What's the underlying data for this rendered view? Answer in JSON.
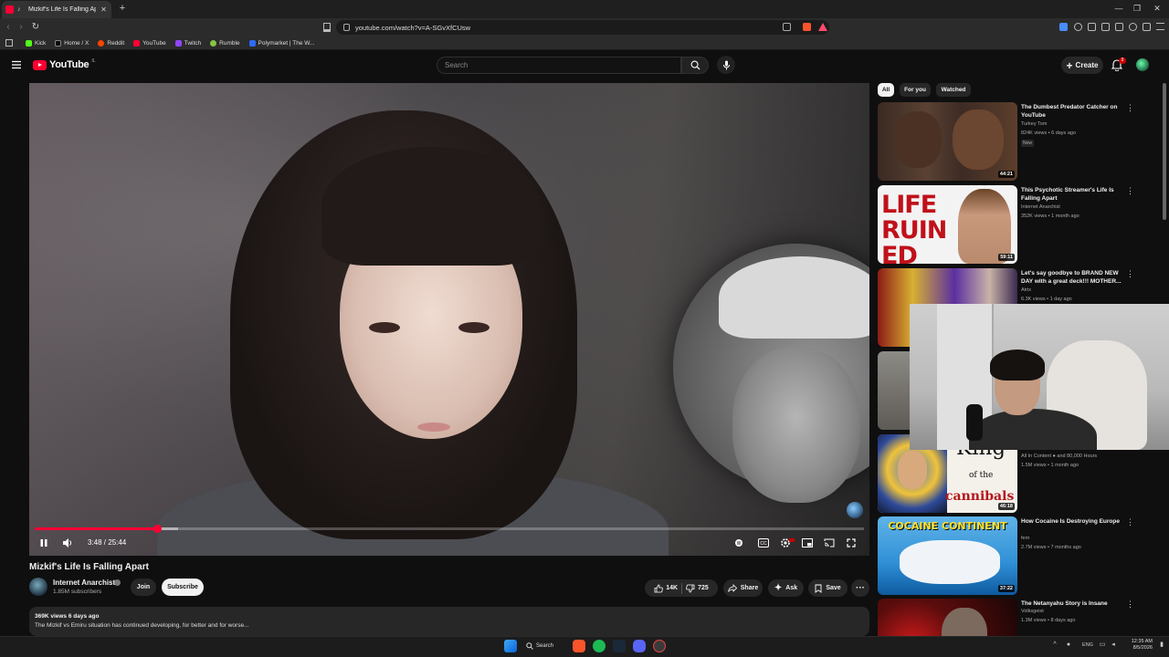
{
  "browser": {
    "tab_title": "Mizkif's Life Is Falling Apart",
    "url": "youtube.com/watch?v=A-SGvXfCUsw",
    "bookmarks": [
      "Kick",
      "Home / X",
      "Reddit",
      "YouTube",
      "Twitch",
      "Rumble",
      "Polymarket | The W..."
    ]
  },
  "header": {
    "logo_text": "YouTube",
    "logo_country": "IL",
    "search_placeholder": "Search",
    "create_label": "Create",
    "notification_count": "9"
  },
  "player": {
    "current_time": "3:48",
    "duration": "25:44",
    "time_display": "3:48 / 25:44",
    "progress_fraction": 0.148,
    "buffered_fraction": 0.173
  },
  "video": {
    "title": "Mizkif's Life Is Falling Apart",
    "channel": "Internet Anarchist",
    "subscribers": "1.85M subscribers",
    "join_label": "Join",
    "subscribe_label": "Subscribe",
    "likes": "14K",
    "dislikes": "725",
    "share_label": "Share",
    "ask_label": "Ask",
    "save_label": "Save",
    "views_date": "369K views  6 days ago",
    "description": "The Mizkif vs Emiru situation has continued developing, for better and for worse..."
  },
  "chips": [
    "All",
    "For you",
    "Watched"
  ],
  "recommendations": [
    {
      "title": "The Dumbest Predator Catcher on YouTube",
      "channel": "Turkey Tom",
      "stats": "824K views • 6 days ago",
      "badge": "New",
      "duration": "44:21"
    },
    {
      "title": "This Psychotic Streamer's Life Is Falling Apart",
      "channel": "Internet Anarchist",
      "stats": "352K views • 1 month ago",
      "duration": "59:11",
      "thumb_text": "LIFE RUINED"
    },
    {
      "title": "Let's say goodbye to BRAND NEW DAY with a great deck!!! MOTHER...",
      "channel": "Atrix",
      "stats": "6.3K views • 1 day ago"
    },
    {
      "title": "",
      "channel": "All In Content",
      "channel_suffix": "and 80,000 Hours",
      "stats": "1.5M views • 1 month ago",
      "duration": "46:18",
      "thumb_text_1": "King",
      "thumb_text_2": "of the",
      "thumb_text_3": "cannibals"
    },
    {
      "title": "How Cocaine Is Destroying Europe",
      "channel": "fern",
      "stats": "2.7M views • 7 months ago",
      "duration": "37:22",
      "thumb_text": "COCAINE CONTINENT"
    },
    {
      "title": "The Netanyahu Story is Insane",
      "channel": "Volksgeist",
      "stats": "1.3M views • 8 days ago"
    }
  ],
  "taskbar": {
    "search_label": "Search",
    "lang": "ENG",
    "time": "12:35 AM",
    "date": "8/5/2026"
  }
}
